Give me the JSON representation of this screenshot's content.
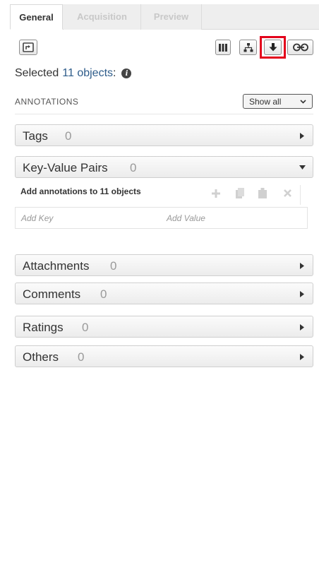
{
  "tabs": [
    {
      "label": "General",
      "active": true
    },
    {
      "label": "Acquisition",
      "active": false
    },
    {
      "label": "Preview",
      "active": false
    }
  ],
  "toolbar": {
    "buttons": [
      {
        "icon": "open-in-viewer-icon"
      },
      {
        "icon": "columns-icon"
      },
      {
        "icon": "hierarchy-icon"
      },
      {
        "icon": "download-icon",
        "highlighted": true
      },
      {
        "icon": "link-icon"
      }
    ]
  },
  "selection": {
    "prefix": "Selected",
    "count": "11 objects",
    "suffix": ":",
    "info_icon": "i"
  },
  "annotations": {
    "title": "ANNOTATIONS",
    "filter_value": "Show all"
  },
  "panels": {
    "tags": {
      "label": "Tags",
      "count": "0"
    },
    "kv": {
      "label": "Key-Value Pairs",
      "count": "0"
    },
    "attachments": {
      "label": "Attachments",
      "count": "0"
    },
    "comments": {
      "label": "Comments",
      "count": "0"
    },
    "ratings": {
      "label": "Ratings",
      "count": "0"
    },
    "others": {
      "label": "Others",
      "count": "0"
    }
  },
  "key_value": {
    "add_text": "Add annotations to 11 objects",
    "key_placeholder": "Add Key",
    "value_placeholder": "Add Value",
    "action_icons": [
      "add-icon",
      "copy-icon",
      "paste-icon",
      "delete-icon"
    ]
  },
  "colors": {
    "highlight": "#e3001b",
    "link_text": "#2e5c8a"
  }
}
